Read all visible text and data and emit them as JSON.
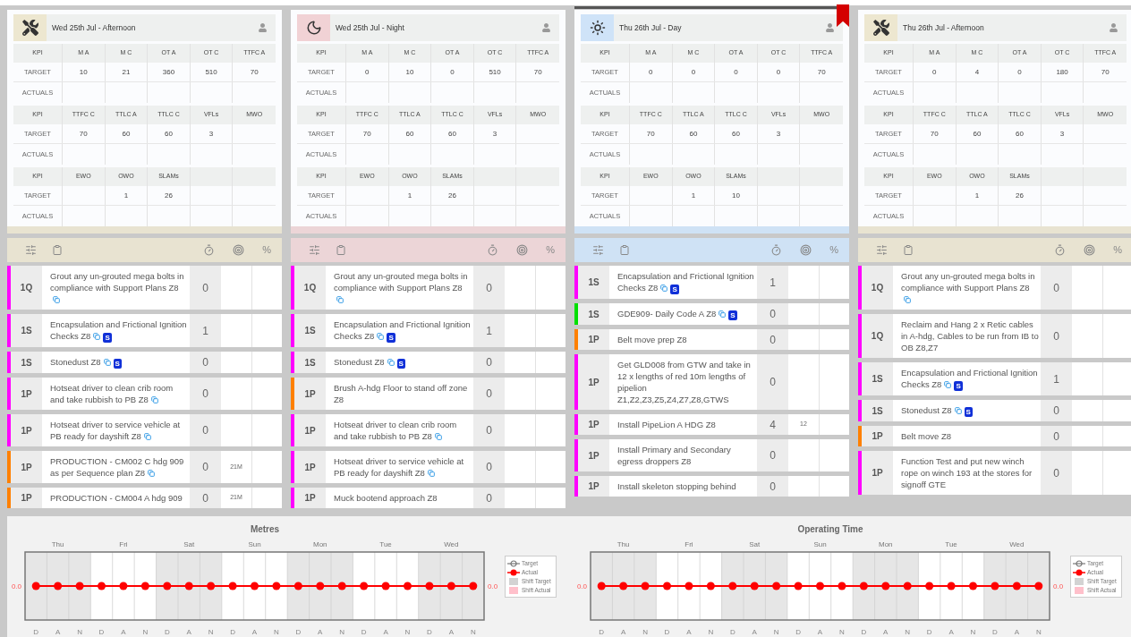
{
  "columns": [
    {
      "kind": "afternoon",
      "current": false,
      "title": "Wed 25th Jul - Afternoon",
      "kpi_tables": [
        {
          "header": [
            "KPI",
            "M A",
            "M C",
            "OT A",
            "OT C",
            "TTFC A"
          ],
          "rows": [
            {
              "label": "TARGET",
              "cells": [
                "10",
                "21",
                "360",
                "510",
                "70"
              ]
            },
            {
              "label": "ACTUALS"
            }
          ]
        },
        {
          "header": [
            "KPI",
            "TTFC C",
            "TTLC A",
            "TTLC C",
            "VFLs",
            "MWO"
          ],
          "rows": [
            {
              "label": "TARGET",
              "cells": [
                "70",
                "60",
                "60",
                "3"
              ]
            },
            {
              "label": "ACTUALS"
            }
          ]
        },
        {
          "header": [
            "KPI",
            "EWO",
            "OWO",
            "SLAMs"
          ],
          "rows": [
            {
              "label": "TARGET",
              "cells": [
                null,
                "1",
                "26"
              ]
            },
            {
              "label": "ACTUALS"
            }
          ]
        }
      ],
      "toolbar_percent": "%",
      "tasks": [
        {
          "code": "1Q",
          "text": "Grout any un-grouted mega bolts in compliance with Support Plans Z8",
          "color": "#ff00ff",
          "linked": true,
          "value": "0"
        },
        {
          "code": "1S",
          "text": "Encapsulation and Frictional Ignition Checks Z8",
          "color": "#ff00ff",
          "linked": true,
          "badge": "S",
          "value": "1"
        },
        {
          "code": "1S",
          "text": "Stonedust Z8",
          "color": "#ff00ff",
          "linked": true,
          "badge": "S",
          "value": "0"
        },
        {
          "code": "1P",
          "text": "Hotseat driver to clean crib room and take rubbish to PB Z8",
          "color": "#ff00ff",
          "linked": true,
          "value": "0"
        },
        {
          "code": "1P",
          "text": "Hotseat driver to service vehicle at PB ready for dayshift Z8",
          "color": "#ff00ff",
          "linked": true,
          "value": "0"
        },
        {
          "code": "1P",
          "text": "PRODUCTION - CM002 C hdg 909 as per Sequence plan Z8",
          "color": "#ff8000",
          "linked": true,
          "value": "0",
          "target": "21M"
        },
        {
          "code": "1P",
          "text": "PRODUCTION - CM004 A hdg 909",
          "color": "#ff8000",
          "linked": false,
          "value": "0",
          "target": "21M"
        }
      ]
    },
    {
      "kind": "night",
      "current": false,
      "title": "Wed 25th Jul - Night",
      "kpi_tables": [
        {
          "header": [
            "KPI",
            "M A",
            "M C",
            "OT A",
            "OT C",
            "TTFC A"
          ],
          "rows": [
            {
              "label": "TARGET",
              "cells": [
                "0",
                "10",
                "0",
                "510",
                "70"
              ]
            },
            {
              "label": "ACTUALS"
            }
          ]
        },
        {
          "header": [
            "KPI",
            "TTFC C",
            "TTLC A",
            "TTLC C",
            "VFLs",
            "MWO"
          ],
          "rows": [
            {
              "label": "TARGET",
              "cells": [
                "70",
                "60",
                "60",
                "3"
              ]
            },
            {
              "label": "ACTUALS"
            }
          ]
        },
        {
          "header": [
            "KPI",
            "EWO",
            "OWO",
            "SLAMs"
          ],
          "rows": [
            {
              "label": "TARGET",
              "cells": [
                null,
                "1",
                "26"
              ]
            },
            {
              "label": "ACTUALS"
            }
          ]
        }
      ],
      "toolbar_percent": "%",
      "tasks": [
        {
          "code": "1Q",
          "text": "Grout any un-grouted mega bolts in compliance with Support Plans Z8",
          "color": "#ff00ff",
          "linked": true,
          "value": "0"
        },
        {
          "code": "1S",
          "text": "Encapsulation and Frictional Ignition Checks Z8",
          "color": "#ff00ff",
          "linked": true,
          "badge": "S",
          "value": "1"
        },
        {
          "code": "1S",
          "text": "Stonedust Z8",
          "color": "#ff00ff",
          "linked": true,
          "badge": "S",
          "value": "0"
        },
        {
          "code": "1P",
          "text": "Brush A-hdg Floor to stand off zone Z8",
          "color": "#ff8000",
          "linked": false,
          "value": "0"
        },
        {
          "code": "1P",
          "text": "Hotseat driver to clean crib room and take rubbish to PB Z8",
          "color": "#ff00ff",
          "linked": true,
          "value": "0"
        },
        {
          "code": "1P",
          "text": "Hotseat driver to service vehicle at PB ready for dayshift Z8",
          "color": "#ff00ff",
          "linked": true,
          "value": "0"
        },
        {
          "code": "1P",
          "text": "Muck bootend approach Z8",
          "color": "#ff00ff",
          "linked": false,
          "value": "0"
        }
      ]
    },
    {
      "kind": "day",
      "current": true,
      "title": "Thu 26th Jul - Day",
      "kpi_tables": [
        {
          "header": [
            "KPI",
            "M A",
            "M C",
            "OT A",
            "OT C",
            "TTFC A"
          ],
          "rows": [
            {
              "label": "TARGET",
              "cells": [
                "0",
                "0",
                "0",
                "0",
                "70"
              ]
            },
            {
              "label": "ACTUALS"
            }
          ]
        },
        {
          "header": [
            "KPI",
            "TTFC C",
            "TTLC A",
            "TTLC C",
            "VFLs",
            "MWO"
          ],
          "rows": [
            {
              "label": "TARGET",
              "cells": [
                "70",
                "60",
                "60",
                "3"
              ]
            },
            {
              "label": "ACTUALS"
            }
          ]
        },
        {
          "header": [
            "KPI",
            "EWO",
            "OWO",
            "SLAMs"
          ],
          "rows": [
            {
              "label": "TARGET",
              "cells": [
                null,
                "1",
                "10"
              ]
            },
            {
              "label": "ACTUALS"
            }
          ]
        }
      ],
      "toolbar_percent": "%",
      "tasks": [
        {
          "code": "1S",
          "text": "Encapsulation and Frictional Ignition Checks Z8",
          "color": "#ff00ff",
          "linked": true,
          "badge": "S",
          "value": "1"
        },
        {
          "code": "1S",
          "text": "GDE909- Daily Code A Z8",
          "color": "#00e000",
          "linked": true,
          "badge": "S",
          "value": "0"
        },
        {
          "code": "1P",
          "text": "Belt move prep Z8",
          "color": "#ff8000",
          "linked": false,
          "value": "0"
        },
        {
          "code": "1P",
          "text": "Get GLD008 from GTW and take in 12 x lengths of red 10m lengths of pipelion Z1,Z2,Z3,Z5,Z4,Z7,Z8,GTWS",
          "color": "#ff00ff",
          "linked": false,
          "value": "0"
        },
        {
          "code": "1P",
          "text": "Install PipeLion A HDG Z8",
          "color": "#ff00ff",
          "linked": false,
          "value": "4",
          "target": "12"
        },
        {
          "code": "1P",
          "text": "Install Primary and Secondary egress droppers Z8",
          "color": "#ff00ff",
          "linked": false,
          "value": "0"
        },
        {
          "code": "1P",
          "text": "Install skeleton stopping behind",
          "color": "#ff00ff",
          "linked": false,
          "value": "0"
        }
      ]
    },
    {
      "kind": "afternoon",
      "current": false,
      "title": "Thu 26th Jul - Afternoon",
      "kpi_tables": [
        {
          "header": [
            "KPI",
            "M A",
            "M C",
            "OT A",
            "OT C",
            "TTFC A"
          ],
          "rows": [
            {
              "label": "TARGET",
              "cells": [
                "0",
                "4",
                "0",
                "180",
                "70"
              ]
            },
            {
              "label": "ACTUALS"
            }
          ]
        },
        {
          "header": [
            "KPI",
            "TTFC C",
            "TTLC A",
            "TTLC C",
            "VFLs",
            "MWO"
          ],
          "rows": [
            {
              "label": "TARGET",
              "cells": [
                "70",
                "60",
                "60",
                "3"
              ]
            },
            {
              "label": "ACTUALS"
            }
          ]
        },
        {
          "header": [
            "KPI",
            "EWO",
            "OWO",
            "SLAMs"
          ],
          "rows": [
            {
              "label": "TARGET",
              "cells": [
                null,
                "1",
                "26"
              ]
            },
            {
              "label": "ACTUALS"
            }
          ]
        }
      ],
      "toolbar_percent": "%",
      "tasks": [
        {
          "code": "1Q",
          "text": "Grout any un-grouted mega bolts in compliance with Support Plans Z8",
          "color": "#ff00ff",
          "linked": true,
          "value": "0"
        },
        {
          "code": "1Q",
          "text": "Reclaim and Hang 2 x Retic cables in A-hdg, Cables to be run from IB to OB Z8,Z7",
          "color": "#ff00ff",
          "linked": false,
          "value": "0"
        },
        {
          "code": "1S",
          "text": "Encapsulation and Frictional Ignition Checks Z8",
          "color": "#ff00ff",
          "linked": true,
          "badge": "S",
          "value": "1"
        },
        {
          "code": "1S",
          "text": "Stonedust Z8",
          "color": "#ff00ff",
          "linked": true,
          "badge": "S",
          "value": "0"
        },
        {
          "code": "1P",
          "text": "Belt move Z8",
          "color": "#ff8000",
          "linked": false,
          "value": "0"
        },
        {
          "code": "1P",
          "text": "Function Test and put new winch rope on winch 193 at the stores for signoff GTE",
          "color": "#ff00ff",
          "linked": false,
          "value": "0"
        }
      ]
    }
  ],
  "charts": [
    {
      "title": "Metres",
      "day_labels": [
        "Thu",
        "Fri",
        "Sat",
        "Sun",
        "Mon",
        "Tue",
        "Wed"
      ],
      "legend": [
        {
          "label": "Target",
          "kind": "target"
        },
        {
          "label": "Actual",
          "kind": "actual"
        },
        {
          "label": "Shift Target",
          "kind": "shift_target"
        },
        {
          "label": "Shift Actual",
          "kind": "shift_actual"
        }
      ],
      "shift_labels": [
        "D",
        "A",
        "N",
        "D",
        "A",
        "N",
        "D",
        "A",
        "N",
        "D",
        "A",
        "N",
        "D",
        "A",
        "N",
        "D",
        "A",
        "N",
        "D",
        "A",
        "N"
      ],
      "value_labels": [
        "0.0",
        "0.0"
      ]
    },
    {
      "title": "Operating Time",
      "day_labels": [
        "Thu",
        "Fri",
        "Sat",
        "Sun",
        "Mon",
        "Tue",
        "Wed"
      ],
      "legend": [
        {
          "label": "Target",
          "kind": "target"
        },
        {
          "label": "Actual",
          "kind": "actual"
        },
        {
          "label": "Shift Target",
          "kind": "shift_target"
        },
        {
          "label": "Shift Actual",
          "kind": "shift_actual"
        }
      ],
      "shift_labels": [
        "D",
        "A",
        "N",
        "D",
        "A",
        "N",
        "D",
        "A",
        "N",
        "D",
        "A",
        "N",
        "D",
        "A",
        "N",
        "D",
        "A",
        "N",
        "D",
        "A",
        "N"
      ],
      "value_labels": [
        "0.0",
        "0.0"
      ]
    }
  ]
}
